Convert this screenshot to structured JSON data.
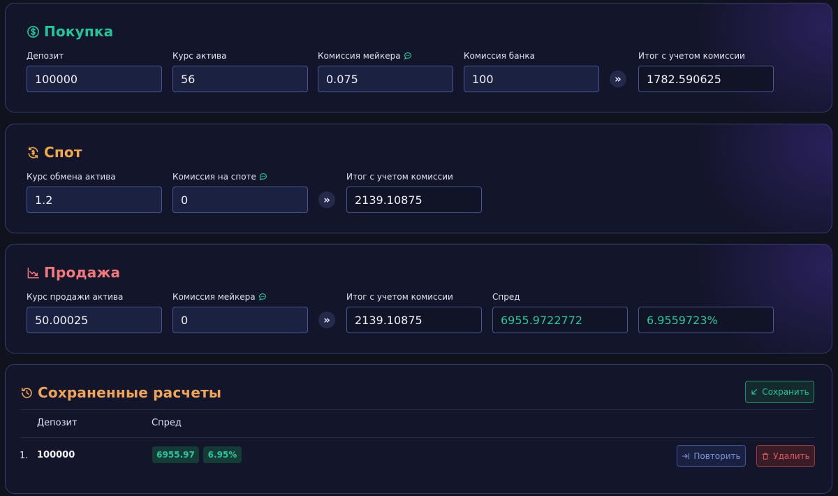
{
  "purchase": {
    "title": "Покупка",
    "fields": [
      {
        "label": "Депозит",
        "value": "100000"
      },
      {
        "label": "Курс актива",
        "value": "56"
      },
      {
        "label": "Комиссия мейкера",
        "value": "0.075"
      },
      {
        "label": "Комиссия банка",
        "value": "100"
      },
      {
        "label": "Итог с учетом комиссии",
        "value": "1782.590625"
      }
    ]
  },
  "spot": {
    "title": "Спот",
    "fields": [
      {
        "label": "Курс обмена актива",
        "value": "1.2"
      },
      {
        "label": "Комиссия на споте",
        "value": "0"
      },
      {
        "label": "Итог с учетом комиссии",
        "value": "2139.10875"
      }
    ]
  },
  "sale": {
    "title": "Продажа",
    "fields": [
      {
        "label": "Курс продажи актива",
        "value": "50.00025"
      },
      {
        "label": "Комиссия мейкера",
        "value": "0"
      },
      {
        "label": "Итог с учетом комиссии",
        "value": "2139.10875"
      },
      {
        "label": "Спред",
        "value": "6955.9722772"
      },
      {
        "value": "6.9559723%"
      }
    ]
  },
  "saved": {
    "title": "Сохраненные расчеты",
    "save_label": "Сохранить",
    "columns": [
      "Депозит",
      "Спред"
    ],
    "rows": [
      {
        "num": "1.",
        "deposit": "100000",
        "spread_value": "6955.97",
        "spread_percent": "6.95%",
        "repeat_label": "Повторить",
        "delete_label": "Удалить"
      }
    ]
  },
  "arrow_glyph": "»",
  "colors": {
    "purchase": "#22c59a",
    "spot": "#f0a84d",
    "sale": "#f2787c",
    "saved": "#f0a45a",
    "accent_green": "#2ec59b"
  },
  "icons": {
    "purchase": "dollar-circle-icon",
    "spot": "exchange-cycle-icon",
    "sale": "trending-down-icon",
    "saved": "history-icon",
    "info": "comment-info-icon"
  }
}
